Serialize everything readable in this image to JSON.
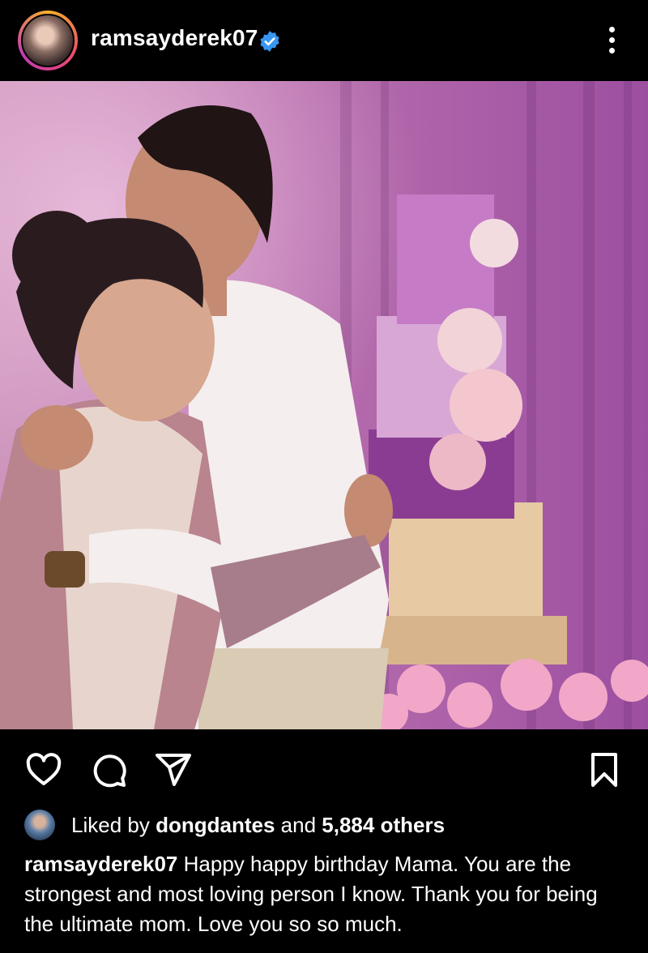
{
  "header": {
    "username": "ramsayderek07",
    "icons": {
      "avatar": "profile-avatar",
      "verified": "verified-badge-icon",
      "more": "more-options-icon"
    }
  },
  "post": {
    "image_description_icon": "post-photo"
  },
  "actions": {
    "icons": [
      "heart-icon",
      "comment-icon",
      "share-icon",
      "bookmark-icon"
    ]
  },
  "likes": {
    "prefix": "Liked by",
    "user": "dongdantes",
    "middle": "and",
    "count": "5,884 others"
  },
  "caption": {
    "username": "ramsayderek07",
    "text": "Happy happy birthday Mama. You are the strongest and most loving person I know. Thank you for being the ultimate mom. Love you so so much."
  },
  "colors": {
    "background": "#000000",
    "text": "#ffffff",
    "verified": "#3897f0",
    "photo_tint": "#b77bb8"
  }
}
